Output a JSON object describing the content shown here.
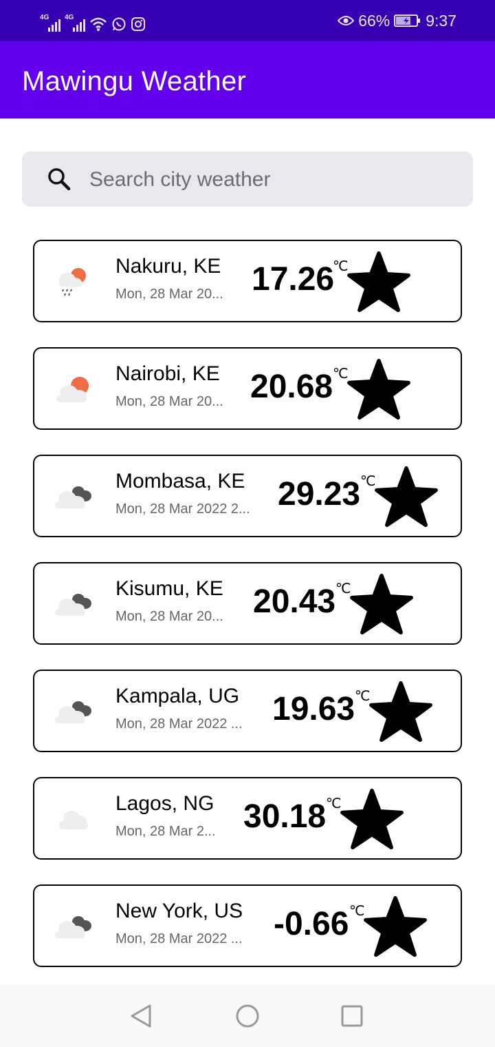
{
  "status_bar": {
    "network_label_1": "4G",
    "network_label_2": "4G",
    "battery": "66%",
    "time": "9:37"
  },
  "app": {
    "title": "Mawingu Weather"
  },
  "search": {
    "placeholder": "Search city weather",
    "value": ""
  },
  "cities": [
    {
      "city": "Nakuru, KE",
      "date": "Mon, 28 Mar 20...",
      "temp": "17.26",
      "unit": "℃",
      "icon": "light-rain-sun-icon"
    },
    {
      "city": "Nairobi, KE",
      "date": "Mon, 28 Mar 20...",
      "temp": "20.68",
      "unit": "℃",
      "icon": "partly-sunny-icon"
    },
    {
      "city": "Mombasa, KE",
      "date": "Mon, 28 Mar 2022 2...",
      "temp": "29.23",
      "unit": "℃",
      "icon": "broken-clouds-icon"
    },
    {
      "city": "Kisumu, KE",
      "date": "Mon, 28 Mar 20...",
      "temp": "20.43",
      "unit": "℃",
      "icon": "broken-clouds-icon"
    },
    {
      "city": "Kampala, UG",
      "date": "Mon, 28 Mar 2022 ...",
      "temp": "19.63",
      "unit": "℃",
      "icon": "broken-clouds-icon"
    },
    {
      "city": "Lagos, NG",
      "date": "Mon, 28 Mar 2...",
      "temp": "30.18",
      "unit": "℃",
      "icon": "cloud-icon"
    },
    {
      "city": "New York, US",
      "date": "Mon, 28 Mar 2022 ...",
      "temp": "-0.66",
      "unit": "℃",
      "icon": "broken-clouds-icon"
    }
  ],
  "colors": {
    "status_bar": "#3700b3",
    "app_bar": "#6200ee",
    "search_bg": "#e8e8ef",
    "sun": "#ef6c44",
    "dark_cloud": "#555555",
    "light_cloud": "#eeeeee"
  }
}
